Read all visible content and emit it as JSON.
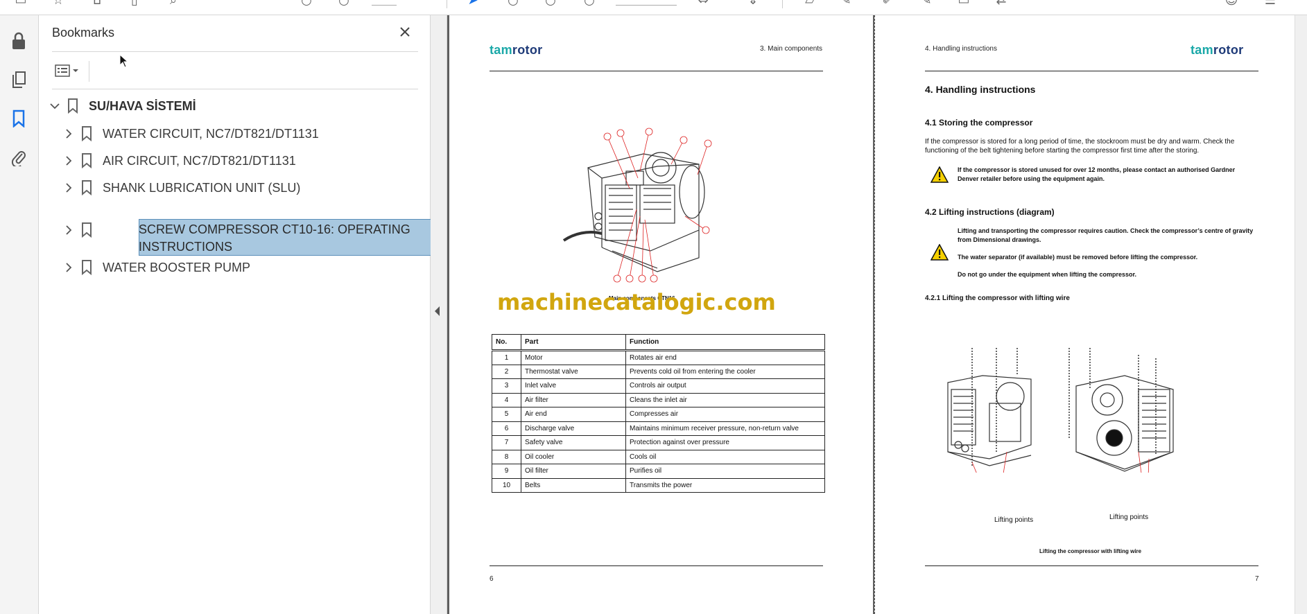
{
  "toolbar": {
    "icons": [
      "print-icon",
      "star-icon",
      "cloud-icon",
      "page-icon",
      "search-icon",
      "arrow-up-icon",
      "arrow-down-icon",
      "page-number-field",
      "cursor-icon",
      "hand-icon",
      "zoom-out-icon",
      "zoom-in-icon",
      "zoom-field",
      "fit-icon",
      "scroll-icon",
      "comment-icon",
      "highlight-icon",
      "draw-icon",
      "edit-icon",
      "stamp-icon",
      "share-icon",
      "account-icon",
      "menu-icon"
    ]
  },
  "rail": {
    "icons": [
      "lock-icon",
      "pages-icon",
      "bookmark-icon",
      "attachment-icon"
    ]
  },
  "bookmarks": {
    "title": "Bookmarks",
    "root": {
      "label": "SU/HAVA SİSTEMİ"
    },
    "items": [
      {
        "label": "WATER CIRCUIT, NC7/DT821/DT1131"
      },
      {
        "label": "AIR CIRCUIT, NC7/DT821/DT1131"
      },
      {
        "label": "SHANK LUBRICATION UNIT (SLU)"
      },
      {
        "label": "SCREW COMPRESSOR CT10-16: OPERATING INSTRUCTIONS"
      },
      {
        "label": "WATER BOOSTER PUMP"
      }
    ]
  },
  "document": {
    "left_page": {
      "logo_part1": "tam",
      "logo_part2": "rotor",
      "header": "3. Main components",
      "figure_caption": "Main components CTN16",
      "watermark": "machinecatalogic.com",
      "table": {
        "headers": [
          "No.",
          "Part",
          "Function"
        ],
        "rows": [
          [
            "1",
            "Motor",
            "Rotates air end"
          ],
          [
            "2",
            "Thermostat valve",
            "Prevents cold oil from entering the cooler"
          ],
          [
            "3",
            "Inlet valve",
            "Controls air output"
          ],
          [
            "4",
            "Air filter",
            "Cleans the inlet air"
          ],
          [
            "5",
            "Air end",
            "Compresses air"
          ],
          [
            "6",
            "Discharge valve",
            "Maintains minimum receiver pressure, non-return valve"
          ],
          [
            "7",
            "Safety valve",
            "Protection against over pressure"
          ],
          [
            "8",
            "Oil cooler",
            "Cools oil"
          ],
          [
            "9",
            "Oil filter",
            "Purifies oil"
          ],
          [
            "10",
            "Belts",
            "Transmits the power"
          ]
        ]
      },
      "page_number": "6"
    },
    "right_page": {
      "header": "4. Handling instructions",
      "logo_part1": "tam",
      "logo_part2": "rotor",
      "heading": "4. Handling instructions",
      "section1_title": "4.1 Storing the compressor",
      "section1_text": "If the compressor is stored for a long period of time, the stockroom must be dry and warm. Check the functioning of the belt tightening before starting the compressor first time after the storing.",
      "warning1": "If the compressor is stored unused for over 12 months, please contact an authorised Gardner Denver retailer before using the equipment again.",
      "section2_title": "4.2 Lifting instructions (diagram)",
      "lifting_text1": "Lifting and transporting the compressor requires caution. Check the compressor’s centre of gravity from Dimensional drawings.",
      "lifting_text2": "The water separator (if available) must be removed before lifting the compressor.",
      "lifting_text3": "Do not go under the equipment when lifting the compressor.",
      "section3_title": "4.2.1 Lifting the compressor with lifting wire",
      "lifting_points_label": "Lifting points",
      "figure_caption": "Lifting the compressor with lifting wire",
      "page_number": "7"
    }
  }
}
